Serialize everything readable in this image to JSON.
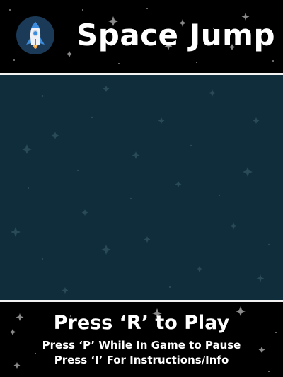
{
  "game": {
    "title": "Space Jump",
    "logo_icon": "rocket-icon",
    "colors": {
      "background": "#000000",
      "playfield": "#0f2d3b",
      "divider": "#f2f2f2",
      "text": "#ffffff",
      "logo_circle": "#1b3a57"
    }
  },
  "footer": {
    "play_prompt": "Press ‘R’ to Play",
    "pause_hint": "Press ‘P’ While In Game to Pause",
    "info_hint": "Press ‘I’ For Instructions/Info"
  }
}
